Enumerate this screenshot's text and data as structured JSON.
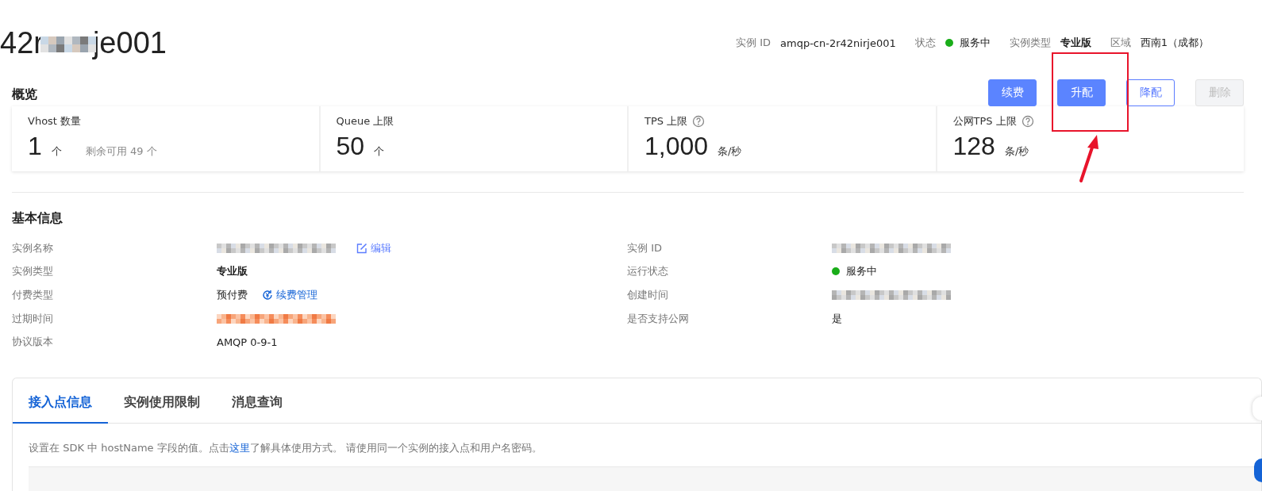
{
  "header": {
    "title_parts": [
      "42r",
      "je001"
    ],
    "meta": [
      {
        "label": "实例 ID",
        "value": "amqp-cn-2r42nirje001",
        "kind": "text"
      },
      {
        "label": "状态",
        "value": "服务中",
        "kind": "status",
        "color": "#1aad19"
      },
      {
        "label": "实例类型",
        "value": "专业版",
        "kind": "bold"
      },
      {
        "label": "区域",
        "value": "西南1（成都）",
        "kind": "text"
      }
    ]
  },
  "overview": {
    "title": "概览",
    "buttons": [
      {
        "label": "续费",
        "kind": "primary",
        "disabled": false
      },
      {
        "label": "升配",
        "kind": "primary",
        "disabled": false
      },
      {
        "label": "降配",
        "kind": "outline",
        "disabled": false
      },
      {
        "label": "删除",
        "kind": "outline",
        "disabled": true
      }
    ],
    "stats": [
      {
        "label": "Vhost 数量",
        "help": false,
        "value": "1",
        "unit": "个",
        "note": "剩余可用 49 个"
      },
      {
        "label": "Queue 上限",
        "help": false,
        "value": "50",
        "unit": "个"
      },
      {
        "label": "TPS 上限",
        "help": true,
        "value": "1,000",
        "unit": "条/秒"
      },
      {
        "label": "公网TPS 上限",
        "help": true,
        "value": "128",
        "unit": "条/秒"
      }
    ]
  },
  "basic_info": {
    "title": "基本信息",
    "left": [
      {
        "label": "实例名称",
        "kind": "redacted",
        "action": {
          "label": "编辑",
          "kind": "edit"
        }
      },
      {
        "label": "实例类型",
        "kind": "bold",
        "value": "专业版"
      },
      {
        "label": "付费类型",
        "kind": "text",
        "value": "预付费",
        "action": {
          "label": "续费管理",
          "kind": "renew"
        }
      },
      {
        "label": "过期时间",
        "kind": "smudged"
      },
      {
        "label": "协议版本",
        "kind": "text",
        "value": "AMQP 0-9-1"
      }
    ],
    "right": [
      {
        "label": "实例 ID",
        "kind": "redacted"
      },
      {
        "label": "运行状态",
        "kind": "status",
        "value": "服务中",
        "color": "#1aad19"
      },
      {
        "label": "创建时间",
        "kind": "redacted"
      },
      {
        "label": "是否支持公网",
        "kind": "text",
        "value": "是"
      }
    ]
  },
  "tabs": {
    "items": [
      {
        "label": "接入点信息",
        "selected": true
      },
      {
        "label": "实例使用限制",
        "selected": false
      },
      {
        "label": "消息查询",
        "selected": false
      }
    ],
    "description": {
      "before": "设置在 SDK 中 hostName 字段的值。点击",
      "link": "这里",
      "after": "了解具体使用方式。 请使用同一个实例的接入点和用户名密码。"
    }
  }
}
